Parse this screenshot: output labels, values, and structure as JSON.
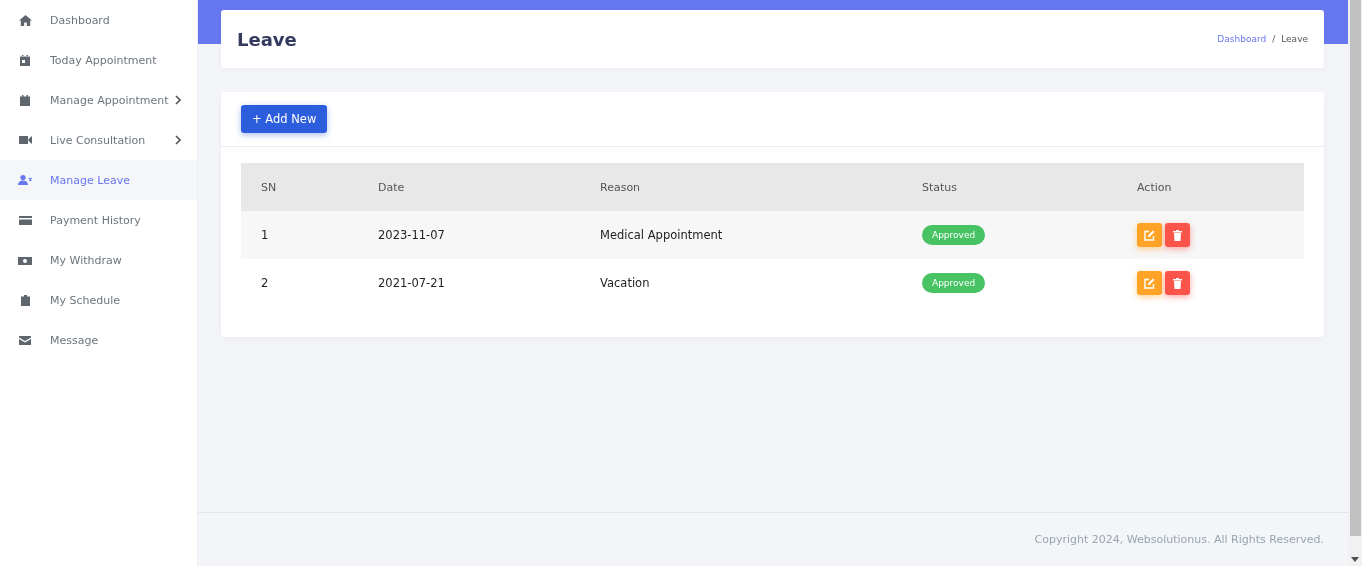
{
  "sidebar": {
    "items": [
      {
        "label": "Dashboard",
        "submenu": false,
        "selected": false
      },
      {
        "label": "Today Appointment",
        "submenu": false,
        "selected": false
      },
      {
        "label": "Manage Appointment",
        "submenu": true,
        "selected": false
      },
      {
        "label": "Live Consultation",
        "submenu": true,
        "selected": false
      },
      {
        "label": "Manage Leave",
        "submenu": false,
        "selected": true
      },
      {
        "label": "Payment History",
        "submenu": false,
        "selected": false
      },
      {
        "label": "My Withdraw",
        "submenu": false,
        "selected": false
      },
      {
        "label": "My Schedule",
        "submenu": false,
        "selected": false
      },
      {
        "label": "Message",
        "submenu": false,
        "selected": false
      }
    ]
  },
  "page_header": {
    "title": "Leave",
    "breadcrumb": [
      {
        "label": "Dashboard",
        "link": true
      },
      {
        "label": "/",
        "link": false
      },
      {
        "label": "Leave",
        "link": false
      }
    ]
  },
  "add_button": {
    "label": "+ Add New"
  },
  "table": {
    "columns": [
      "SN",
      "Date",
      "Reason",
      "Status",
      "Action"
    ],
    "rows": [
      {
        "sn": "1",
        "date": "2023-11-07",
        "reason": "Medical Appointment",
        "status": "Approved"
      },
      {
        "sn": "2",
        "date": "2021-07-21",
        "reason": "Vacation",
        "status": "Approved"
      }
    ]
  },
  "footer": {
    "text": "Copyright 2024, Websolutionus. All Rights Reserved."
  }
}
